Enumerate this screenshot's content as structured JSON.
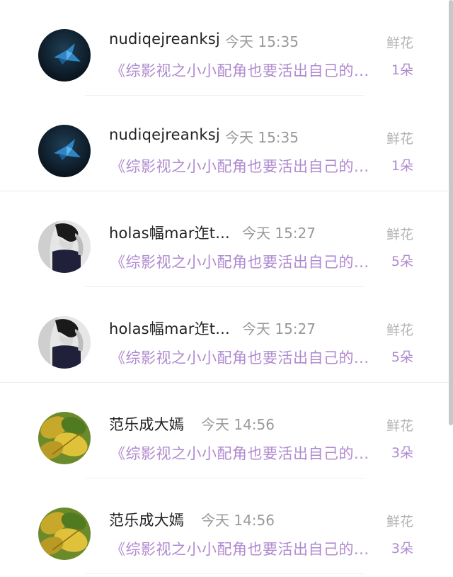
{
  "items": [
    {
      "user": "nudiqejreanksj",
      "time": "今天 15:35",
      "book": "《综影视之小小配角也要活出自己的...",
      "gift_label": "鲜花",
      "gift_count": "1朵",
      "avatar_icon": "paper-crane-avatar"
    },
    {
      "user": "nudiqejreanksj",
      "time": "今天 15:35",
      "book": "《综影视之小小配角也要活出自己的...",
      "gift_label": "鲜花",
      "gift_count": "1朵",
      "avatar_icon": "paper-crane-avatar"
    },
    {
      "user": "holas幅mar迮t...",
      "time": "今天 15:27",
      "book": "《综影视之小小配角也要活出自己的...",
      "gift_label": "鲜花",
      "gift_count": "5朵",
      "avatar_icon": "portrait-avatar"
    },
    {
      "user": "holas幅mar迮t...",
      "time": "今天 15:27",
      "book": "《综影视之小小配角也要活出自己的...",
      "gift_label": "鲜花",
      "gift_count": "5朵",
      "avatar_icon": "portrait-avatar"
    },
    {
      "user": "范乐成大嫣",
      "time": "今天 14:56",
      "book": "《综影视之小小配角也要活出自己的...",
      "gift_label": "鲜花",
      "gift_count": "3朵",
      "avatar_icon": "yellow-leaves-avatar"
    },
    {
      "user": "范乐成大嫣",
      "time": "今天 14:56",
      "book": "《综影视之小小配角也要活出自己的...",
      "gift_label": "鲜花",
      "gift_count": "3朵",
      "avatar_icon": "yellow-leaves-avatar"
    }
  ],
  "colors": {
    "accent_purple": "#b08ad0",
    "name_text": "#222222",
    "meta_text": "#999999"
  }
}
